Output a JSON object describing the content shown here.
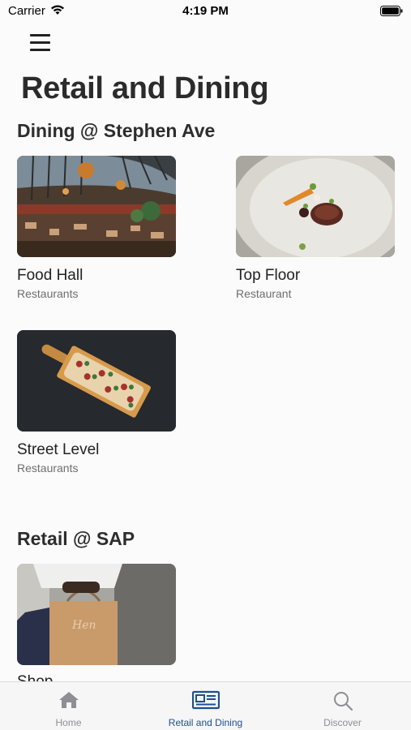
{
  "status_bar": {
    "carrier": "Carrier",
    "time": "4:19 PM"
  },
  "header": {
    "title": "Retail and Dining"
  },
  "sections": [
    {
      "title": "Dining @ Stephen Ave",
      "items": [
        {
          "name": "Food Hall",
          "subtitle": "Restaurants",
          "image": "food-hall-photo"
        },
        {
          "name": "Top Floor",
          "subtitle": "Restaurant",
          "image": "plated-dish-photo"
        },
        {
          "name": "Street Level",
          "subtitle": "Restaurants",
          "image": "flatbread-photo"
        }
      ]
    },
    {
      "title": "Retail @ SAP",
      "items": [
        {
          "name": "Shop",
          "subtitle": "",
          "image": "shopping-bag-photo"
        }
      ]
    }
  ],
  "tab_bar": {
    "tabs": [
      {
        "label": "Home",
        "icon": "house-icon",
        "active": false
      },
      {
        "label": "Retail and Dining",
        "icon": "newspaper-icon",
        "active": true
      },
      {
        "label": "Discover",
        "icon": "magnifier-icon",
        "active": false
      }
    ],
    "active_color": "#1d4f91",
    "inactive_color": "#8e8e93"
  }
}
